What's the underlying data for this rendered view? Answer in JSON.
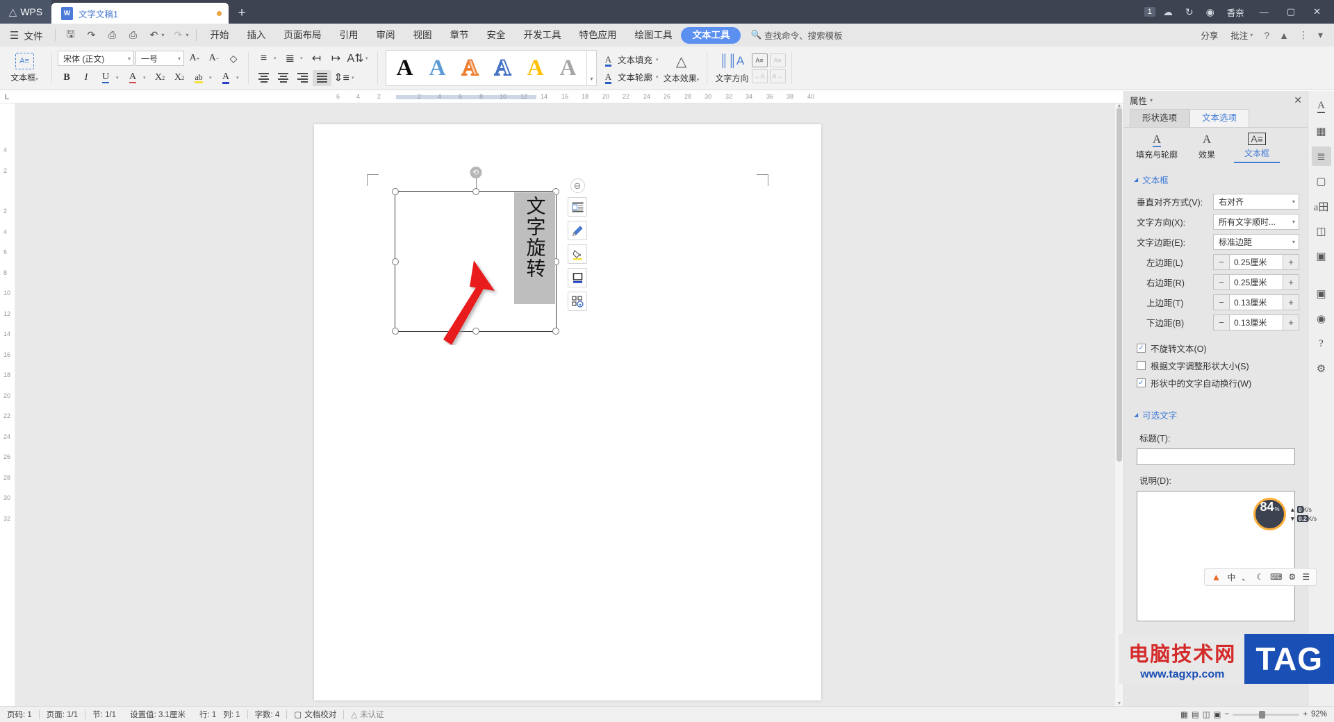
{
  "titlebar": {
    "logo": "WPS",
    "tab_name": "文字文稿1",
    "tab_icon": "W",
    "plus": "+",
    "page_count_badge": "1",
    "cloud_icon": "cloud-icon",
    "sync_icon": "sync-icon",
    "user_label": "香奈",
    "minimize": "—",
    "maximize": "▢",
    "close": "✕",
    "help": "?"
  },
  "menubar": {
    "hamburger": "☰",
    "file": "文件",
    "quick": [
      "save-icon",
      "save-as-icon",
      "print-icon",
      "print-preview-icon",
      "undo-icon",
      "redo-icon",
      "customize-icon"
    ],
    "tabs": [
      {
        "label": "开始",
        "active": false
      },
      {
        "label": "插入",
        "active": false
      },
      {
        "label": "页面布局",
        "active": false
      },
      {
        "label": "引用",
        "active": false
      },
      {
        "label": "审阅",
        "active": false
      },
      {
        "label": "视图",
        "active": false
      },
      {
        "label": "章节",
        "active": false
      },
      {
        "label": "安全",
        "active": false
      },
      {
        "label": "开发工具",
        "active": false
      },
      {
        "label": "特色应用",
        "active": false
      },
      {
        "label": "绘图工具",
        "active": false
      },
      {
        "label": "文本工具",
        "active": true
      }
    ],
    "search_placeholder": "查找命令、搜索模板",
    "share": "分享",
    "review": "批注",
    "review_caret": "▾"
  },
  "ribbon": {
    "textbox_group": {
      "label": "文本框",
      "caret": "▾",
      "icon": "textbox-icon"
    },
    "font": {
      "name": "宋体 (正文)",
      "size": "一号",
      "grow": "A",
      "grow_sup": "+",
      "shrink": "A",
      "shrink_sup": "−",
      "clear_format": "clear-format-icon",
      "bold": "B",
      "italic": "I",
      "underline": "U",
      "strike": "A",
      "superscript": "X",
      "superscript_sup": "2",
      "subscript": "X",
      "subscript_sub": "2",
      "highlight": "ab",
      "fontcolor": "A"
    },
    "paragraph": {
      "bullets": "bullet-list-icon",
      "numbering": "numbered-list-icon",
      "decrease_indent": "decrease-indent-icon",
      "increase_indent": "increase-indent-icon",
      "sort": "sort-icon",
      "align_left": "align-left-icon",
      "align_center": "align-center-icon",
      "align_right": "align-right-icon",
      "align_justify": "align-justify-icon",
      "line_spacing": "line-spacing-icon",
      "line_spacing_caret": "▾"
    },
    "wordart": {
      "styles": [
        "A",
        "A",
        "A",
        "A",
        "A",
        "A"
      ],
      "colors": [
        "#000000",
        "#5b9bd5",
        "#ed7d31",
        "#ffffff",
        "#ffc000",
        "#a5a5a5"
      ],
      "outlines": [
        "#000000",
        "#5b9bd5",
        "#ed7d31",
        "#4472c4",
        "#ffc000",
        "#a5a5a5"
      ],
      "more": "▾"
    },
    "text_fill": {
      "label": "文本填充",
      "caret": "▾",
      "icon": "text-fill-icon"
    },
    "text_outline": {
      "label": "文本轮廓",
      "caret": "▾",
      "icon": "text-outline-icon"
    },
    "text_effect": {
      "label": "文本效果",
      "caret": "▾",
      "icon": "text-effect-icon"
    },
    "text_direction": {
      "label": "文字方向",
      "icon": "text-direction-icon"
    },
    "link_boxes": [
      "create-link-icon",
      "break-link-icon",
      "prev-box-icon",
      "next-box-icon"
    ]
  },
  "ruler": {
    "corner_mark": "L",
    "h_ticks": [
      "6",
      "4",
      "2",
      "2",
      "4",
      "6",
      "8",
      "10",
      "12",
      "14",
      "16",
      "18",
      "20",
      "22",
      "24",
      "26",
      "28",
      "30",
      "32",
      "34",
      "36",
      "38",
      "40"
    ],
    "v_ticks": [
      "4",
      "2",
      "2",
      "4",
      "6",
      "8",
      "10",
      "12",
      "14",
      "16",
      "18",
      "20",
      "22",
      "24",
      "26",
      "28",
      "30",
      "32"
    ]
  },
  "document": {
    "textbox_text": "文字旋转",
    "rotate_handle": "rotate-handle-icon",
    "mini_toolbar": [
      {
        "icon": "collapse-icon",
        "name": "collapse-toolbar-button"
      },
      {
        "icon": "layout-options-icon",
        "name": "layout-options-button"
      },
      {
        "icon": "format-brush-icon",
        "name": "format-painter-button"
      },
      {
        "icon": "fill-color-icon",
        "name": "fill-color-button"
      },
      {
        "icon": "shape-outline-icon",
        "name": "shape-outline-button"
      },
      {
        "icon": "more-options-icon",
        "name": "more-options-button"
      }
    ]
  },
  "properties": {
    "title": "属性",
    "title_caret": "▾",
    "close": "✕",
    "tabs": [
      {
        "label": "形状选项",
        "active": false
      },
      {
        "label": "文本选项",
        "active": true
      }
    ],
    "icon_tabs": [
      {
        "label": "填充与轮廓",
        "icon": "fill-outline-icon",
        "active": false
      },
      {
        "label": "效果",
        "icon": "effects-icon",
        "active": false
      },
      {
        "label": "文本框",
        "icon": "textbox-icon",
        "active": true
      }
    ],
    "section_textbox": "文本框",
    "fields": [
      {
        "label": "垂直对齐方式(V):",
        "value": "右对齐",
        "type": "select",
        "name": "vertical-align-select"
      },
      {
        "label": "文字方向(X):",
        "value": "所有文字顺时...",
        "type": "select",
        "name": "text-direction-select"
      },
      {
        "label": "文字边距(E):",
        "value": "标准边距",
        "type": "select",
        "name": "text-margin-select"
      }
    ],
    "spinners": [
      {
        "label": "左边距(L)",
        "value": "0.25厘米",
        "name": "left-margin-spinner"
      },
      {
        "label": "右边距(R)",
        "value": "0.25厘米",
        "name": "right-margin-spinner"
      },
      {
        "label": "上边距(T)",
        "value": "0.13厘米",
        "name": "top-margin-spinner"
      },
      {
        "label": "下边距(B)",
        "value": "0.13厘米",
        "name": "bottom-margin-spinner"
      }
    ],
    "checkboxes": [
      {
        "label": "不旋转文本(O)",
        "checked": true,
        "name": "no-rotate-text-checkbox"
      },
      {
        "label": "根据文字调整形状大小(S)",
        "checked": false,
        "name": "autofit-shape-checkbox"
      },
      {
        "label": "形状中的文字自动换行(W)",
        "checked": true,
        "name": "wrap-text-checkbox"
      }
    ],
    "section_alttext": "可选文字",
    "alt_title_label": "标题(T):",
    "alt_title_value": "",
    "alt_desc_label": "说明(D):",
    "alt_desc_value": "",
    "minus": "−",
    "plus": "+",
    "check": "✓",
    "tri": "◢"
  },
  "rail": {
    "items": [
      {
        "icon": "text-style-icon",
        "name": "rail-text-style",
        "selected": false
      },
      {
        "icon": "table-icon",
        "name": "rail-table",
        "selected": false
      },
      {
        "icon": "properties-icon",
        "name": "rail-properties",
        "selected": true
      },
      {
        "icon": "picture-icon",
        "name": "rail-picture",
        "selected": false
      },
      {
        "icon": "translate-icon",
        "name": "rail-translate",
        "selected": false
      },
      {
        "icon": "header-footer-icon",
        "name": "rail-header-footer",
        "selected": false
      },
      {
        "icon": "image-tool-icon",
        "name": "rail-image-tool",
        "selected": false
      },
      {
        "icon": "shield-icon",
        "name": "rail-security",
        "selected": false
      },
      {
        "icon": "help-icon",
        "name": "rail-help",
        "selected": false
      },
      {
        "icon": "feedback-icon",
        "name": "rail-feedback",
        "selected": false
      }
    ]
  },
  "status": {
    "items": [
      {
        "label": "页码: 1",
        "name": "status-page-number"
      },
      {
        "label": "页面: 1/1",
        "name": "status-page-count"
      },
      {
        "label": "节: 1/1",
        "name": "status-section"
      },
      {
        "label": "设置值: 3.1厘米",
        "name": "status-setting-value"
      },
      {
        "label": "行: 1",
        "name": "status-row"
      },
      {
        "label": "列: 1",
        "name": "status-column"
      },
      {
        "label": "字数: 4",
        "name": "status-word-count"
      },
      {
        "label": "文档校对",
        "name": "status-proofread",
        "icon": "proofread-icon"
      },
      {
        "label": "未认证",
        "name": "status-unverified",
        "icon": "shield-icon"
      }
    ],
    "zoom": "92%",
    "view_icons": [
      "page-view-icon",
      "outline-view-icon",
      "web-view-icon",
      "read-view-icon"
    ],
    "zoom_out": "−",
    "zoom_in": "+"
  },
  "overlays": {
    "netspeed": {
      "value": "84",
      "unit": "%",
      "up": "0",
      "up_unit": "K/s",
      "down": "0.2",
      "down_unit": "K/s"
    },
    "ime": {
      "logo": "ime-logo-icon",
      "mode": "中",
      "items": [
        "comma-icon",
        "moon-icon",
        "keyboard-icon",
        "tools-icon",
        "menu-icon"
      ]
    },
    "watermark": {
      "line1": "电脑技术网",
      "line2": "www.tagxp.com",
      "tag": "TAG"
    }
  }
}
